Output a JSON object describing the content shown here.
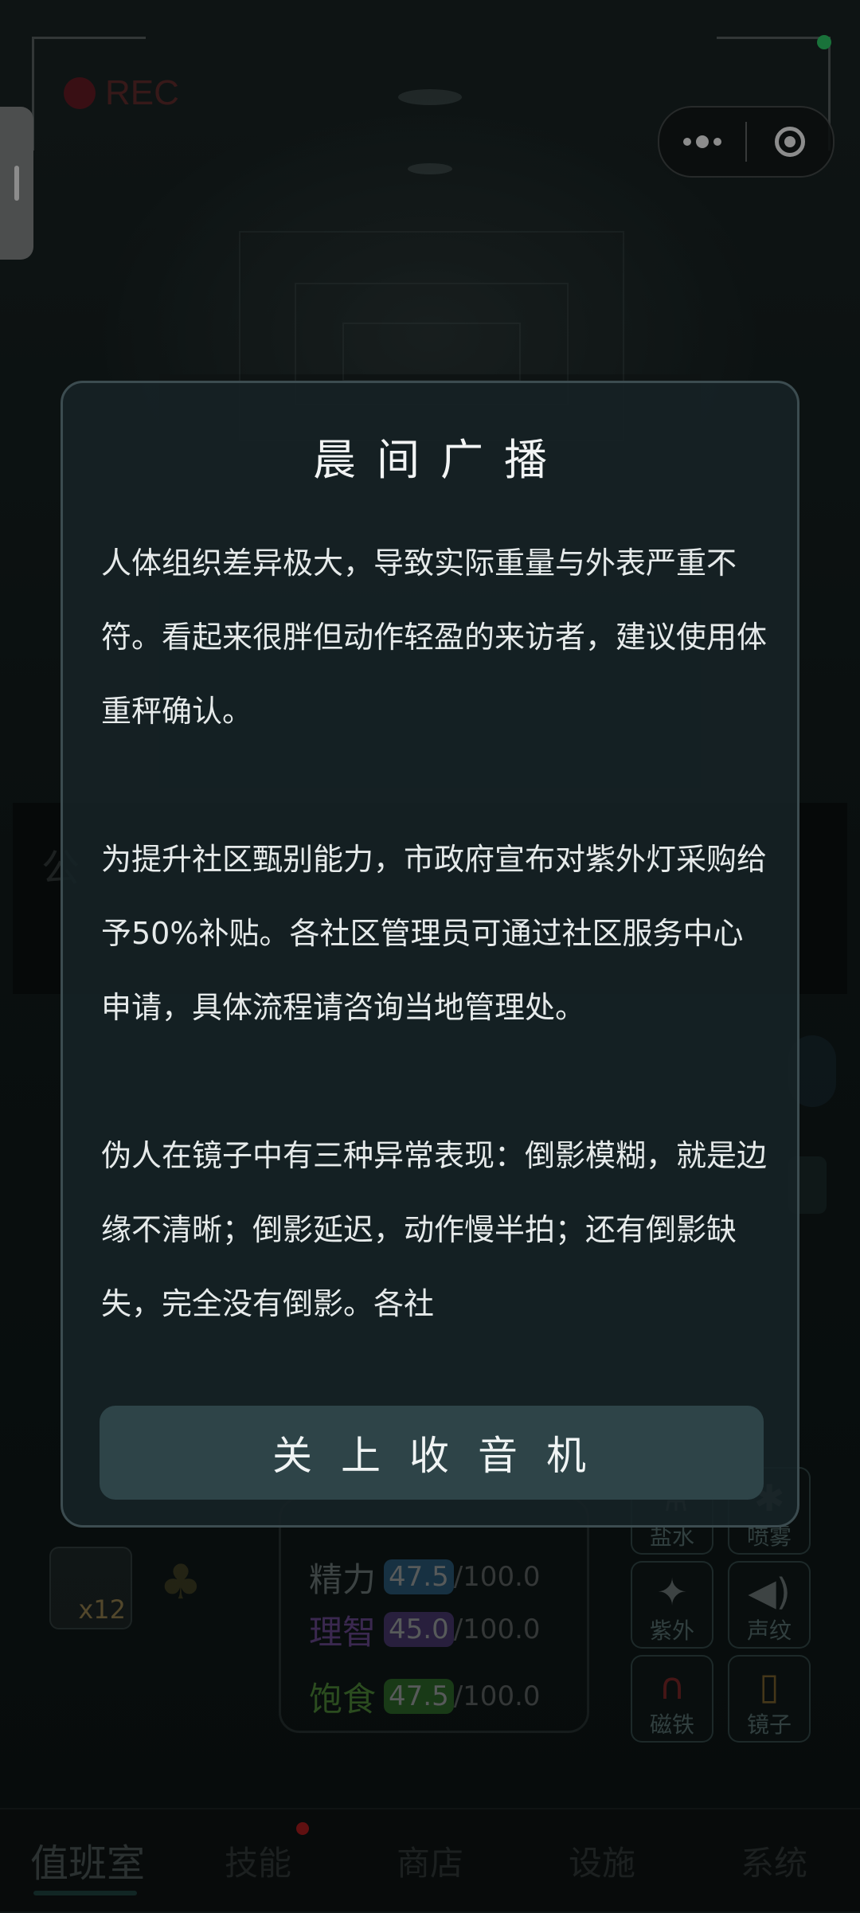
{
  "hud": {
    "rec_label": "REC"
  },
  "background": {
    "faint_char": "公"
  },
  "stats": [
    {
      "name": "精力",
      "value": "47.5",
      "max": "/100.0",
      "name_color": "#6e7a7a",
      "badge_color": "#2a5a78"
    },
    {
      "name": "理智",
      "value": "45.0",
      "max": "/100.0",
      "name_color": "#6a4a90",
      "badge_color": "#4a3a70"
    },
    {
      "name": "饱食",
      "value": "47.5",
      "max": "/100.0",
      "name_color": "#4f8a3a",
      "badge_color": "#2f6a2a"
    }
  ],
  "inventory": {
    "can_count": "x12"
  },
  "tools": [
    {
      "label": "盐水",
      "icon": "salt-water-icon"
    },
    {
      "label": "喷雾",
      "icon": "spray-icon"
    },
    {
      "label": "紫外",
      "icon": "flashlight-icon"
    },
    {
      "label": "声纹",
      "icon": "speaker-icon"
    },
    {
      "label": "磁铁",
      "icon": "magnet-icon"
    },
    {
      "label": "镜子",
      "icon": "mirror-icon"
    }
  ],
  "modal": {
    "title": "晨间广播",
    "paragraphs": [
      "人体组织差异极大，导致实际重量与外表严重不符。看起来很胖但动作轻盈的来访者，建议使用体重秤确认。",
      "为提升社区甄别能力，市政府宣布对紫外灯采购给予50%补贴。各社区管理员可通过社区服务中心申请，具体流程请咨询当地管理处。",
      "伪人在镜子中有三种异常表现：倒影模糊，就是边缘不清晰；倒影延迟，动作慢半拍；还有倒影缺失，完全没有倒影。各社"
    ],
    "close_button": "关上收音机"
  },
  "tabbar": {
    "tabs": [
      {
        "label": "值班室",
        "active": true
      },
      {
        "label": "技能",
        "active": false,
        "badge": true
      },
      {
        "label": "商店",
        "active": false
      },
      {
        "label": "设施",
        "active": false
      },
      {
        "label": "系统",
        "active": false
      }
    ]
  },
  "colors": {
    "accent": "#2e4448",
    "badge_red": "#b01e20",
    "status_green": "#2fd06a"
  }
}
